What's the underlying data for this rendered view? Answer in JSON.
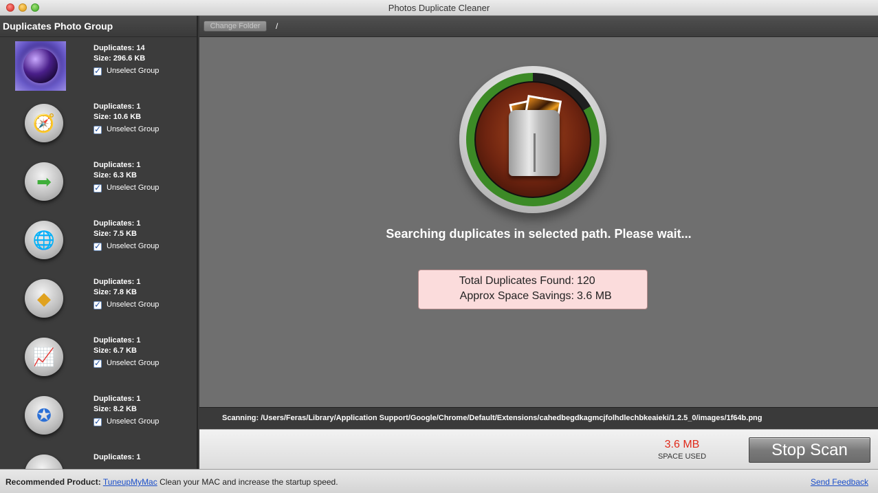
{
  "window": {
    "title": "Photos Duplicate Cleaner"
  },
  "sidebar": {
    "header": "Duplicates Photo Group",
    "groups": [
      {
        "icon": "purple-orb-photo",
        "duplicates": "Duplicates: 14",
        "size": "Size: 296.6 KB",
        "checkbox_label": "Unselect Group"
      },
      {
        "icon": "safari-compass-icon",
        "duplicates": "Duplicates: 1",
        "size": "Size: 10.6 KB",
        "checkbox_label": "Unselect Group"
      },
      {
        "icon": "green-arrow-icon",
        "duplicates": "Duplicates: 1",
        "size": "Size: 6.3 KB",
        "checkbox_label": "Unselect Group"
      },
      {
        "icon": "globe-icon",
        "duplicates": "Duplicates: 1",
        "size": "Size: 7.5 KB",
        "checkbox_label": "Unselect Group"
      },
      {
        "icon": "shapes-icon",
        "duplicates": "Duplicates: 1",
        "size": "Size: 7.8 KB",
        "checkbox_label": "Unselect Group"
      },
      {
        "icon": "chart-monitor-icon",
        "duplicates": "Duplicates: 1",
        "size": "Size: 6.7 KB",
        "checkbox_label": "Unselect Group"
      },
      {
        "icon": "star-badge-icon",
        "duplicates": "Duplicates: 1",
        "size": "Size: 8.2 KB",
        "checkbox_label": "Unselect Group"
      },
      {
        "icon": "warning-icon",
        "duplicates": "Duplicates: 1",
        "size": "",
        "checkbox_label": ""
      }
    ]
  },
  "toolbar": {
    "change_folder_label": "Change Folder",
    "path": "/"
  },
  "main": {
    "message": "Searching duplicates in selected path. Please wait...",
    "stats": {
      "total_label": "Total Duplicates Found:",
      "total_value": "120",
      "savings_label": "Approx Space Savings:",
      "savings_value": "3.6 MB"
    }
  },
  "scan": {
    "text": "Scanning: /Users/Feras/Library/Application Support/Google/Chrome/Default/Extensions/cahedbegdkagmcjfolhdlechbkeaieki/1.2.5_0/images/1f64b.png"
  },
  "bottom": {
    "space_size": "3.6 MB",
    "space_label": "SPACE USED",
    "stop_label": "Stop Scan"
  },
  "footer": {
    "recommended_label": "Recommended Product:",
    "product_link": "TuneupMyMac",
    "product_desc": " Clean your MAC and increase the startup speed.",
    "feedback_link": "Send Feedback"
  },
  "colors": {
    "space_used": "#e02a1a",
    "stats_bg": "#fbdcdc",
    "link": "#1a4ec9"
  }
}
